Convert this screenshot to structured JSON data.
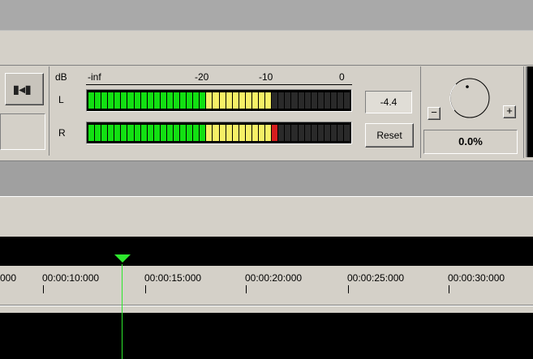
{
  "meter": {
    "db_label": "dB",
    "scale": [
      "-inf",
      "-20",
      "-10",
      "0"
    ],
    "channels": [
      {
        "label": "L",
        "green": 18,
        "yellow": 10,
        "red": 0,
        "off": 12
      },
      {
        "label": "R",
        "green": 18,
        "yellow": 10,
        "red": 1,
        "off": 11
      }
    ],
    "peak_value": "-4.4",
    "reset_label": "Reset",
    "colors": {
      "green": "#12e012",
      "yellow": "#f6f066",
      "red": "#d61e1e",
      "off": "#2a2a2a"
    }
  },
  "toolbar": {
    "mix_icon": "transport-icon"
  },
  "pan": {
    "minus_label": "−",
    "plus_label": "+",
    "value": "0.0%"
  },
  "timeline": {
    "labels": [
      "000",
      "00:00:10:000",
      "00:00:15:000",
      "00:00:20:000",
      "00:00:25:000",
      "00:00:30:000"
    ],
    "cursor_color": "#2ee82e"
  }
}
